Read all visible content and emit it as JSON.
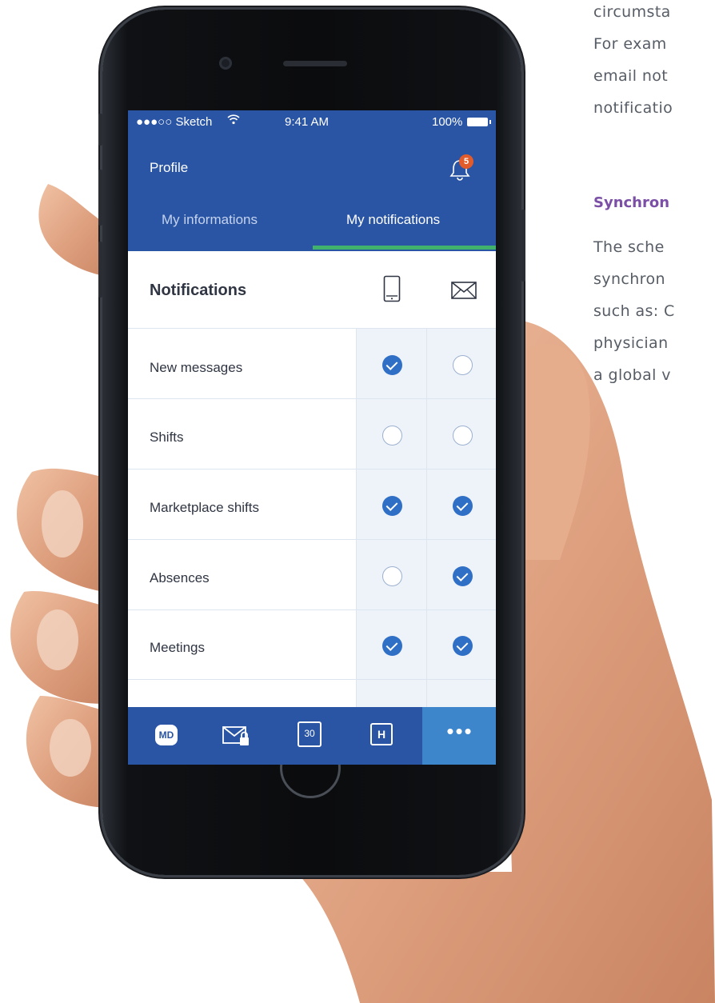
{
  "page": {
    "text_lines": [
      "circumsta",
      "For exam",
      "email not",
      "notificatio"
    ],
    "heading": "Synchron",
    "text_lines_2": [
      "The sche",
      "synchron",
      "such as: C",
      "physician",
      "a global v"
    ],
    "heading_color": "#7b4fa6"
  },
  "status_bar": {
    "carrier": "●●●○○ Sketch",
    "wifi_icon": "wifi-icon",
    "time": "9:41 AM",
    "battery": "100%"
  },
  "app_bar": {
    "title": "Profile",
    "notifications_count": "5",
    "background": "#2a55a4"
  },
  "tabs": [
    {
      "label": "My informations",
      "active": false
    },
    {
      "label": "My notifications",
      "active": true
    }
  ],
  "notifications": {
    "title": "Notifications",
    "column_icons": [
      "smartphone-icon",
      "envelope-icon"
    ],
    "rows": [
      {
        "label": "New messages",
        "push": true,
        "email": false
      },
      {
        "label": "Shifts",
        "push": false,
        "email": false
      },
      {
        "label": "Marketplace shifts",
        "push": true,
        "email": true
      },
      {
        "label": "Absences",
        "push": false,
        "email": true
      },
      {
        "label": "Meetings",
        "push": true,
        "email": true
      }
    ]
  },
  "bottom_nav": {
    "items": [
      {
        "icon": "md-logo-icon",
        "label": "MD"
      },
      {
        "icon": "secure-mail-icon",
        "label": ""
      },
      {
        "icon": "calendar-icon",
        "label": "30"
      },
      {
        "icon": "hospital-icon",
        "label": "H"
      },
      {
        "icon": "more-icon",
        "label": "•••"
      }
    ],
    "active_index": 4
  },
  "colors": {
    "primary": "#2a55a4",
    "accent_green": "#40b26b",
    "check_blue": "#2f6fc6",
    "badge_orange": "#e25c2b",
    "nav_active": "#3d86cc"
  }
}
